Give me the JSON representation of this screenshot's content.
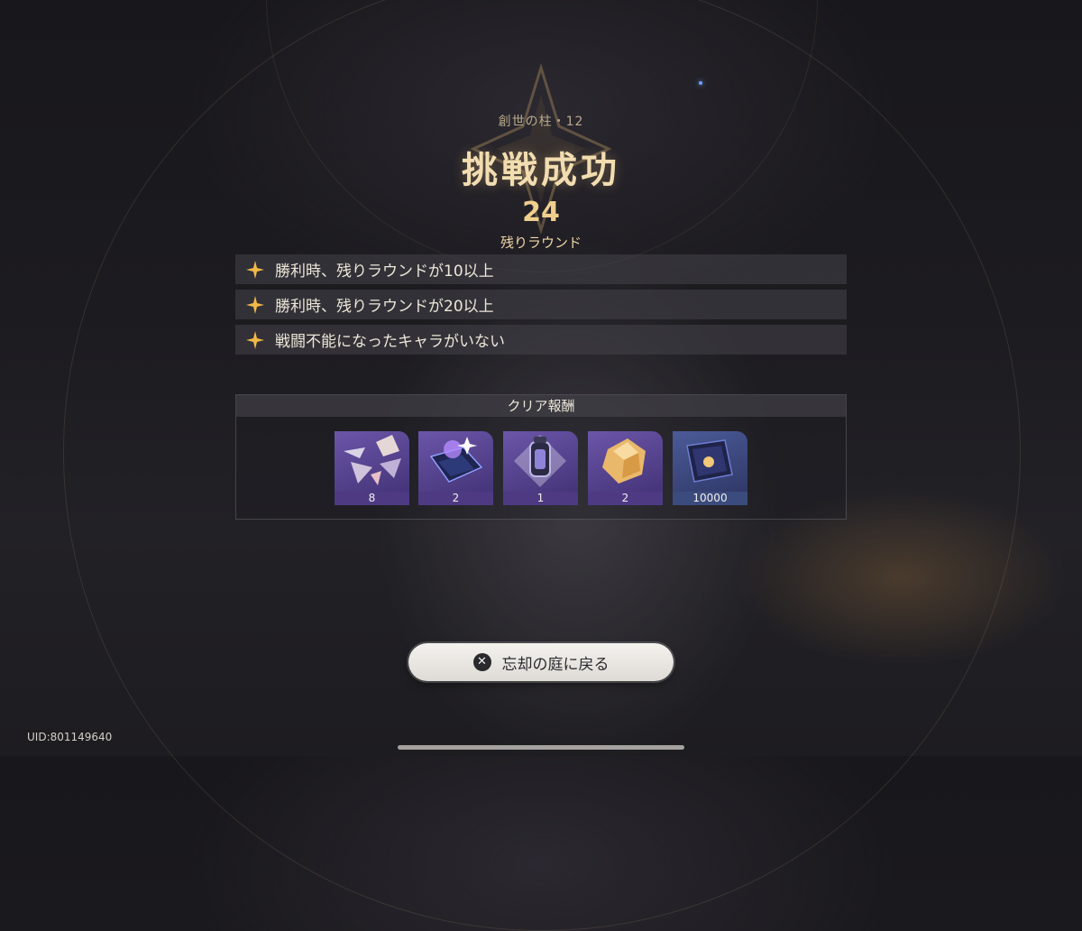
{
  "header": {
    "stage_name": "創世の柱・12",
    "result_title": "挑戦成功",
    "remaining_rounds_value": "24",
    "remaining_rounds_label": "残りラウンド"
  },
  "conditions": [
    {
      "text": "勝利時、残りラウンドが10以上",
      "achieved": true
    },
    {
      "text": "勝利時、残りラウンドが20以上",
      "achieved": true
    },
    {
      "text": "戦闘不能になったキャラがいない",
      "achieved": true
    }
  ],
  "rewards": {
    "title": "クリア報酬",
    "items": [
      {
        "icon": "shard-fragments-icon",
        "count": "8",
        "rarity_color": "#4d3a83"
      },
      {
        "icon": "book-material-icon",
        "count": "2",
        "rarity_color": "#4d3a83"
      },
      {
        "icon": "lantern-relic-icon",
        "count": "1",
        "rarity_color": "#4d3a83"
      },
      {
        "icon": "gold-crystal-icon",
        "count": "2",
        "rarity_color": "#4d3a83"
      },
      {
        "icon": "credit-card-icon",
        "count": "10000",
        "rarity_color": "#3b4b7e"
      }
    ]
  },
  "footer": {
    "back_button_label": "忘却の庭に戻る",
    "back_button_icon": "close-x-icon",
    "uid": "UID:801149640"
  },
  "colors": {
    "title_gold": "#f2ddb0",
    "star_gold": "#f2b948",
    "purple_rarity": "#4d3a83",
    "blue_rarity": "#3b4b7e"
  }
}
